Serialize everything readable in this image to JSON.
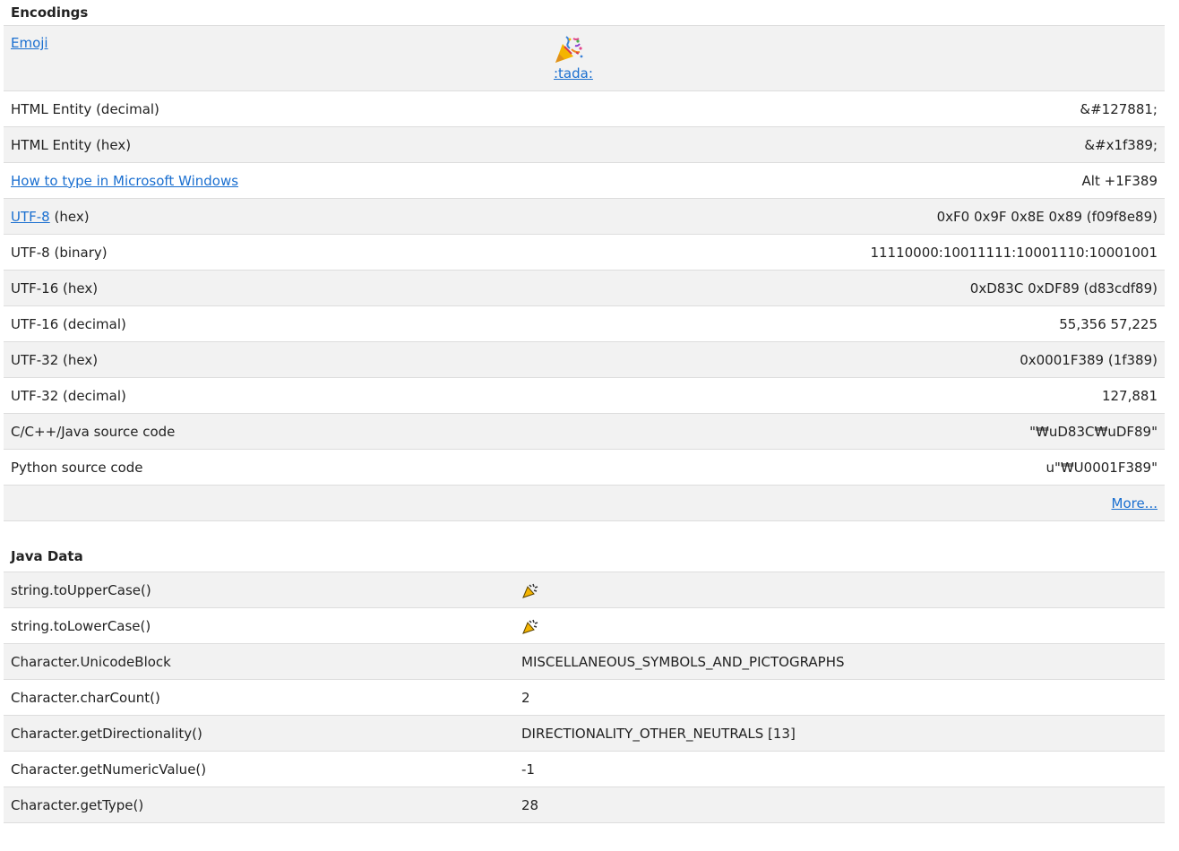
{
  "encodings": {
    "title": "Encodings",
    "emoji_row": {
      "label": "Emoji",
      "shortcode": ":tada:",
      "icon": "party-popper-icon"
    },
    "rows": [
      {
        "label": "HTML Entity (decimal)",
        "value": "&#127881;"
      },
      {
        "label": "HTML Entity (hex)",
        "value": "&#x1f389;"
      },
      {
        "label": "How to type in Microsoft Windows",
        "value": "Alt +1F389",
        "link": true
      },
      {
        "label_link": "UTF-8",
        "label_rest": " (hex)",
        "value": "0xF0 0x9F 0x8E 0x89 (f09f8e89)"
      },
      {
        "label": "UTF-8 (binary)",
        "value": "11110000:10011111:10001110:10001001"
      },
      {
        "label": "UTF-16 (hex)",
        "value": "0xD83C 0xDF89 (d83cdf89)"
      },
      {
        "label": "UTF-16 (decimal)",
        "value": "55,356 57,225"
      },
      {
        "label": "UTF-32 (hex)",
        "value": "0x0001F389 (1f389)"
      },
      {
        "label": "UTF-32 (decimal)",
        "value": "127,881"
      },
      {
        "label": "C/C++/Java source code",
        "value": "\"₩uD83C₩uDF89\""
      },
      {
        "label": "Python source code",
        "value": "u\"₩U0001F389\""
      }
    ],
    "more_label": "More..."
  },
  "java": {
    "title": "Java Data",
    "rows": [
      {
        "label": "string.toUpperCase()",
        "value": "",
        "icon": "party-popper-icon"
      },
      {
        "label": "string.toLowerCase()",
        "value": "",
        "icon": "party-popper-icon"
      },
      {
        "label": "Character.UnicodeBlock",
        "value": "MISCELLANEOUS_SYMBOLS_AND_PICTOGRAPHS"
      },
      {
        "label": "Character.charCount()",
        "value": "2"
      },
      {
        "label": "Character.getDirectionality()",
        "value": "DIRECTIONALITY_OTHER_NEUTRALS [13]"
      },
      {
        "label": "Character.getNumericValue()",
        "value": "-1"
      },
      {
        "label": "Character.getType()",
        "value": "28"
      }
    ]
  },
  "colors": {
    "link": "#1a6fd0",
    "row_shade": "#f2f2f2",
    "border": "#dddddd"
  }
}
